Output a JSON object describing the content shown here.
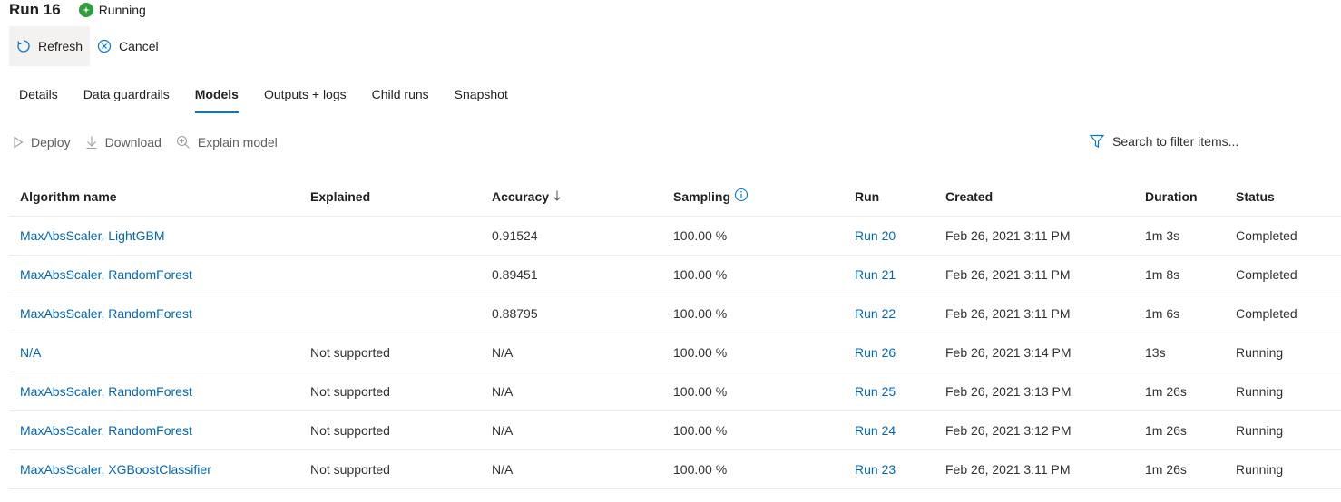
{
  "header": {
    "title": "Run 16",
    "status": "Running",
    "status_color": "#2e9e3a"
  },
  "commands": {
    "refresh": "Refresh",
    "cancel": "Cancel"
  },
  "tabs": [
    {
      "label": "Details"
    },
    {
      "label": "Data guardrails"
    },
    {
      "label": "Models",
      "selected": true
    },
    {
      "label": "Outputs + logs"
    },
    {
      "label": "Child runs"
    },
    {
      "label": "Snapshot"
    }
  ],
  "actions": {
    "deploy": "Deploy",
    "download": "Download",
    "explain": "Explain model"
  },
  "search": {
    "placeholder": "Search to filter items..."
  },
  "table": {
    "headers": {
      "algorithm": "Algorithm name",
      "explained": "Explained",
      "accuracy": "Accuracy",
      "sampling": "Sampling",
      "run": "Run",
      "created": "Created",
      "duration": "Duration",
      "status": "Status"
    },
    "rows": [
      {
        "algorithm": "MaxAbsScaler, LightGBM",
        "explained": "",
        "accuracy": "0.91524",
        "sampling": "100.00 %",
        "run": "Run 20",
        "created": "Feb 26, 2021 3:11 PM",
        "duration": "1m 3s",
        "status": "Completed"
      },
      {
        "algorithm": "MaxAbsScaler, RandomForest",
        "explained": "",
        "accuracy": "0.89451",
        "sampling": "100.00 %",
        "run": "Run 21",
        "created": "Feb 26, 2021 3:11 PM",
        "duration": "1m 8s",
        "status": "Completed"
      },
      {
        "algorithm": "MaxAbsScaler, RandomForest",
        "explained": "",
        "accuracy": "0.88795",
        "sampling": "100.00 %",
        "run": "Run 22",
        "created": "Feb 26, 2021 3:11 PM",
        "duration": "1m 6s",
        "status": "Completed"
      },
      {
        "algorithm": "N/A",
        "explained": "Not supported",
        "accuracy": "N/A",
        "sampling": "100.00 %",
        "run": "Run 26",
        "created": "Feb 26, 2021 3:14 PM",
        "duration": "13s",
        "status": "Running"
      },
      {
        "algorithm": "MaxAbsScaler, RandomForest",
        "explained": "Not supported",
        "accuracy": "N/A",
        "sampling": "100.00 %",
        "run": "Run 25",
        "created": "Feb 26, 2021 3:13 PM",
        "duration": "1m 26s",
        "status": "Running"
      },
      {
        "algorithm": "MaxAbsScaler, RandomForest",
        "explained": "Not supported",
        "accuracy": "N/A",
        "sampling": "100.00 %",
        "run": "Run 24",
        "created": "Feb 26, 2021 3:12 PM",
        "duration": "1m 26s",
        "status": "Running"
      },
      {
        "algorithm": "MaxAbsScaler, XGBoostClassifier",
        "explained": "Not supported",
        "accuracy": "N/A",
        "sampling": "100.00 %",
        "run": "Run 23",
        "created": "Feb 26, 2021 3:11 PM",
        "duration": "1m 26s",
        "status": "Running"
      }
    ]
  },
  "colors": {
    "accent": "#0078d4",
    "link": "#0067b8"
  }
}
